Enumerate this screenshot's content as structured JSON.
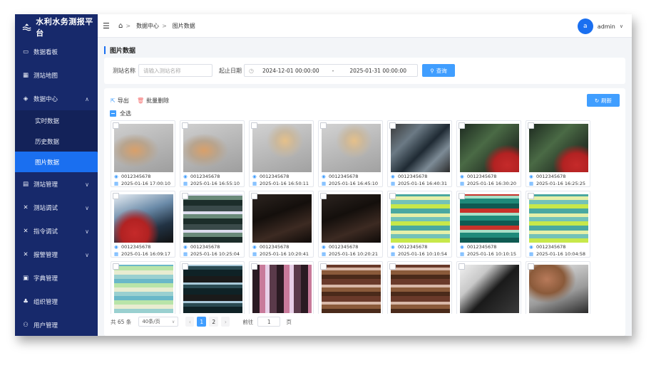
{
  "app": {
    "title": "水利水务测报平台"
  },
  "sidebar": {
    "items": [
      {
        "label": "数据看板",
        "icon": "dashboard-icon",
        "chevron": false
      },
      {
        "label": "测站地图",
        "icon": "map-icon",
        "chevron": false
      },
      {
        "label": "数据中心",
        "icon": "layers-icon",
        "chevron": true,
        "expanded": true,
        "children": [
          "实时数据",
          "历史数据",
          "图片数据"
        ],
        "active_child": "图片数据"
      },
      {
        "label": "测站管理",
        "icon": "list-icon",
        "chevron": true
      },
      {
        "label": "测站调试",
        "icon": "tools-icon",
        "chevron": true
      },
      {
        "label": "指令调试",
        "icon": "tools-icon",
        "chevron": true
      },
      {
        "label": "报警管理",
        "icon": "tools-icon",
        "chevron": true
      },
      {
        "label": "字典管理",
        "icon": "monitor-icon",
        "chevron": false
      },
      {
        "label": "组织管理",
        "icon": "org-icon",
        "chevron": false
      },
      {
        "label": "用户管理",
        "icon": "user-icon",
        "chevron": false
      }
    ]
  },
  "header": {
    "breadcrumb": [
      "数据中心",
      "图片数据"
    ],
    "breadcrumb_sep": ">",
    "user": {
      "avatar": "a",
      "name": "admin"
    }
  },
  "page": {
    "title": "图片数据"
  },
  "filters": {
    "station_label": "测站名称",
    "station_placeholder": "请输入测站名称",
    "date_label": "起止日期",
    "start": "2024-12-01 00:00:00",
    "dash": "-",
    "end": "2025-01-31 00:00:00",
    "search_label": "查询"
  },
  "toolbar": {
    "export_label": "导出",
    "batch_delete_label": "批量删除",
    "refresh_label": "刷新",
    "select_all_label": "全选"
  },
  "photos": [
    {
      "station": "0012345678",
      "time": "2025-01-16 17:00:10",
      "style": "gray-orange"
    },
    {
      "station": "0012345678",
      "time": "2025-01-16 16:55:10",
      "style": "gray-orange"
    },
    {
      "station": "0012345678",
      "time": "2025-01-16 16:50:11",
      "style": "gray-yellow"
    },
    {
      "station": "0012345678",
      "time": "2025-01-16 16:45:10",
      "style": "gray-yellow"
    },
    {
      "station": "0012345678",
      "time": "2025-01-16 16:40:31",
      "style": "cable-dark"
    },
    {
      "station": "0012345678",
      "time": "2025-01-16 16:30:20",
      "style": "green-red"
    },
    {
      "station": "0012345678",
      "time": "2025-01-16 16:25:25",
      "style": "green-red"
    },
    {
      "station": "0012345678",
      "time": "2025-01-16 16:09:17",
      "style": "blue-red"
    },
    {
      "station": "0012345678",
      "time": "2025-01-16 10:25:04",
      "style": "glitch-green"
    },
    {
      "station": "0012345678",
      "time": "2025-01-16 10:20:41",
      "style": "dark-brown"
    },
    {
      "station": "0012345678",
      "time": "2025-01-16 10:20:21",
      "style": "dark-brown"
    },
    {
      "station": "0012345678",
      "time": "2025-01-16 10:10:54",
      "style": "glitch-lime"
    },
    {
      "station": "0012345678",
      "time": "2025-01-16 10:10:15",
      "style": "glitch-teal"
    },
    {
      "station": "0012345678",
      "time": "2025-01-16 10:04:58",
      "style": "glitch-lime"
    },
    {
      "station": "",
      "time": "",
      "style": "glitch-cyan"
    },
    {
      "station": "",
      "time": "",
      "style": "glitch-dark"
    },
    {
      "station": "",
      "time": "",
      "style": "glitch-pink"
    },
    {
      "station": "",
      "time": "",
      "style": "brown-stripes"
    },
    {
      "station": "",
      "time": "",
      "style": "brown-stripes"
    },
    {
      "station": "",
      "time": "",
      "style": "dark-white"
    },
    {
      "station": "",
      "time": "",
      "style": "brown-white"
    }
  ],
  "pagination": {
    "total_text": "共 65 条",
    "page_size": "40条/页",
    "pages": [
      "1",
      "2"
    ],
    "current": "1",
    "goto_prefix": "前往",
    "goto_value": "1",
    "goto_suffix": "页"
  },
  "colors": {
    "sidebar": "#17296b",
    "accent": "#1a6ff0",
    "button": "#409eff"
  }
}
